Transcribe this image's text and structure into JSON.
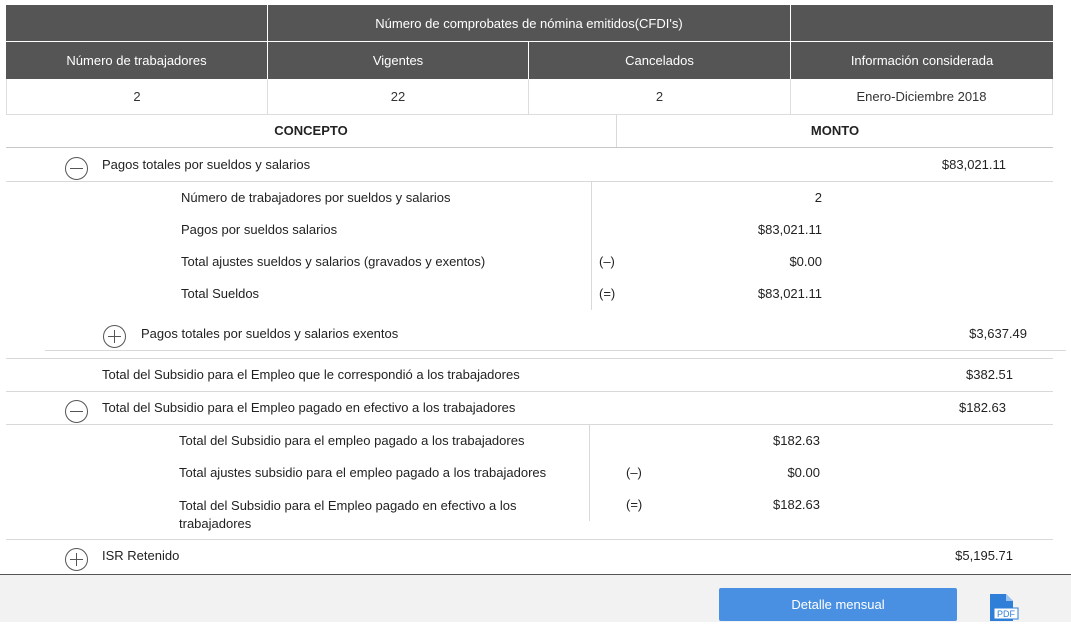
{
  "summary_table": {
    "group_header": "Número de comprobates de nómina emitidos(CFDI's)",
    "columns": [
      "Número de trabajadores",
      "Vigentes",
      "Cancelados",
      "Información considerada"
    ],
    "row": [
      "2",
      "22",
      "2",
      "Enero-Diciembre 2018"
    ]
  },
  "detail_header": {
    "concepto": "CONCEPTO",
    "monto": "MONTO"
  },
  "sections": {
    "sueldos": {
      "label": "Pagos totales por sueldos y salarios",
      "amount": "$83,021.11",
      "rows": [
        {
          "label": "Número de trabajadores por sueldos y salarios",
          "op": "",
          "amount": "2"
        },
        {
          "label": "Pagos por sueldos salarios",
          "op": "",
          "amount": "$83,021.11"
        },
        {
          "label": "Total ajustes sueldos y salarios (gravados y exentos)",
          "op": "(–)",
          "amount": "$0.00"
        },
        {
          "label": "Total Sueldos",
          "op": "(=)",
          "amount": "$83,021.11"
        }
      ]
    },
    "exentos": {
      "label": "Pagos totales por sueldos y salarios exentos",
      "amount": "$3,637.49"
    },
    "subsidio_correspondio": {
      "label": "Total del Subsidio para el Empleo que le correspondió a los trabajadores",
      "amount": "$382.51"
    },
    "subsidio_pagado": {
      "label": "Total del Subsidio para el Empleo pagado en efectivo a los trabajadores",
      "amount": "$182.63",
      "rows": [
        {
          "label": "Total del Subsidio para el empleo pagado a los trabajadores",
          "op": "",
          "amount": "$182.63"
        },
        {
          "label": "Total ajustes subsidio para el empleo pagado a los trabajadores",
          "op": "(–)",
          "amount": "$0.00"
        },
        {
          "label": "Total del Subsidio para el Empleo pagado en efectivo a los trabajadores",
          "op": "(=)",
          "amount": "$182.63"
        }
      ]
    },
    "isr": {
      "label": "ISR Retenido",
      "amount": "$5,195.71"
    }
  },
  "footer": {
    "detail_button": "Detalle mensual",
    "pdf_label": "PDF"
  },
  "colors": {
    "header_bg": "#555555",
    "button_bg": "#4a90e2",
    "pdf_icon": "#2f7fd8"
  }
}
